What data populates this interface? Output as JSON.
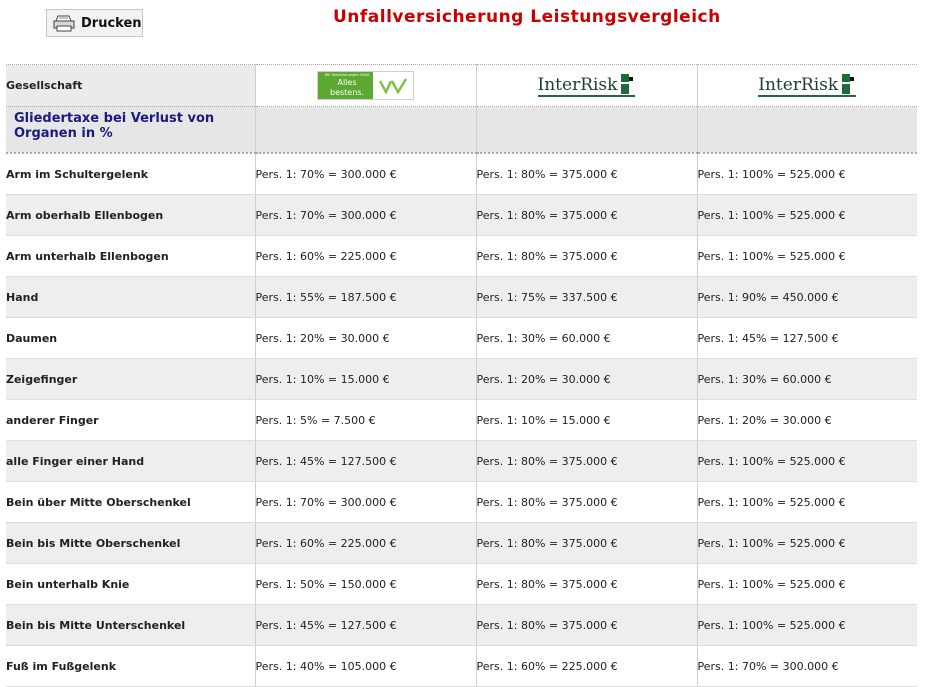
{
  "toolbar": {
    "print_label": "Drucken",
    "print_icon": "printer-icon"
  },
  "page": {
    "title": "Unfallversicherung Leistungsvergleich"
  },
  "header": {
    "label": "Gesellschaft",
    "companies": [
      {
        "logo": "vv-logo",
        "logo_small": "Wir Versicherungen VVaG",
        "logo_text": "Alles bestens.",
        "logo_mark": "VV"
      },
      {
        "logo": "interrisk-logo",
        "logo_text": "InterRisk"
      },
      {
        "logo": "interrisk-logo",
        "logo_text": "InterRisk"
      }
    ]
  },
  "section": {
    "title": "Gliedertaxe bei Verlust von Organen in %"
  },
  "rows": [
    {
      "label": "Arm im Schultergelenk",
      "values": [
        "Pers. 1: 70% = 300.000 €",
        "Pers. 1: 80% = 375.000 €",
        "Pers. 1: 100% = 525.000 €"
      ]
    },
    {
      "label": "Arm oberhalb Ellenbogen",
      "values": [
        "Pers. 1: 70% = 300.000 €",
        "Pers. 1: 80% = 375.000 €",
        "Pers. 1: 100% = 525.000 €"
      ]
    },
    {
      "label": "Arm unterhalb Ellenbogen",
      "values": [
        "Pers. 1: 60% = 225.000 €",
        "Pers. 1: 80% = 375.000 €",
        "Pers. 1: 100% = 525.000 €"
      ]
    },
    {
      "label": "Hand",
      "values": [
        "Pers. 1: 55% = 187.500 €",
        "Pers. 1: 75% = 337.500 €",
        "Pers. 1: 90% = 450.000 €"
      ]
    },
    {
      "label": "Daumen",
      "values": [
        "Pers. 1: 20% = 30.000 €",
        "Pers. 1: 30% = 60.000 €",
        "Pers. 1: 45% = 127.500 €"
      ]
    },
    {
      "label": "Zeigefinger",
      "values": [
        "Pers. 1: 10% = 15.000 €",
        "Pers. 1: 20% = 30.000 €",
        "Pers. 1: 30% = 60.000 €"
      ]
    },
    {
      "label": "anderer Finger",
      "values": [
        "Pers. 1: 5% = 7.500 €",
        "Pers. 1: 10% = 15.000 €",
        "Pers. 1: 20% = 30.000 €"
      ]
    },
    {
      "label": "alle Finger einer Hand",
      "values": [
        "Pers. 1: 45% = 127.500 €",
        "Pers. 1: 80% = 375.000 €",
        "Pers. 1: 100% = 525.000 €"
      ]
    },
    {
      "label": "Bein über Mitte Oberschenkel",
      "values": [
        "Pers. 1: 70% = 300.000 €",
        "Pers. 1: 80% = 375.000 €",
        "Pers. 1: 100% = 525.000 €"
      ]
    },
    {
      "label": "Bein bis Mitte Oberschenkel",
      "values": [
        "Pers. 1: 60% = 225.000 €",
        "Pers. 1: 80% = 375.000 €",
        "Pers. 1: 100% = 525.000 €"
      ]
    },
    {
      "label": "Bein unterhalb Knie",
      "values": [
        "Pers. 1: 50% = 150.000 €",
        "Pers. 1: 80% = 375.000 €",
        "Pers. 1: 100% = 525.000 €"
      ]
    },
    {
      "label": "Bein bis Mitte Unterschenkel",
      "values": [
        "Pers. 1: 45% = 127.500 €",
        "Pers. 1: 80% = 375.000 €",
        "Pers. 1: 100% = 525.000 €"
      ]
    },
    {
      "label": "Fuß im Fußgelenk",
      "values": [
        "Pers. 1: 40% = 105.000 €",
        "Pers. 1: 60% = 225.000 €",
        "Pers. 1: 70% = 300.000 €"
      ]
    }
  ]
}
